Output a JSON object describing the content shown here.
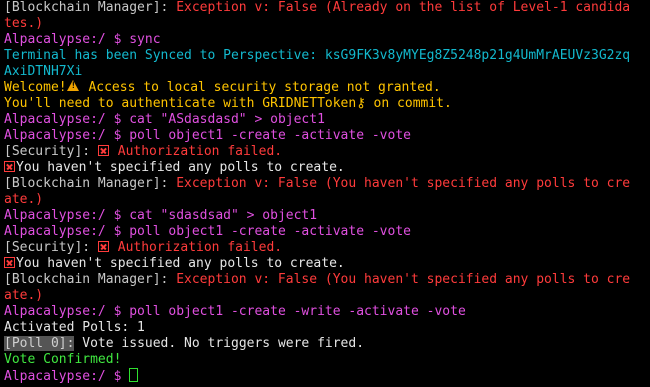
{
  "prompt": "Alpacalypse:/ $",
  "lines": {
    "l1_a": "[Blockchain Manager]: ",
    "l1_b": "Exception v: False (Already on the list of Level-1 candida",
    "l2": "tes.)",
    "l3_cmd": " sync",
    "l4": "Terminal has been Synced to Perspective: ksG9FK3v8yMYEg8Z5248p21g4UmMrAEUVz3G2zq",
    "l5": "AxiDTNH7Xi",
    "l6_a": "Welcome!",
    "l6_b": " Access to local security storage not granted.",
    "l7_a": "You'll need to authenticate with GRIDNETToken",
    "l7_key": "⚷",
    "l7_b": " on commit.",
    "l8_cmd": " cat \"ASdasdasd\" > object1",
    "l9_cmd": " poll object1 -create -activate -vote",
    "l10_a": "[Security]: ",
    "l10_b": " Authorization failed.",
    "l11": "You haven't specified any polls to create.",
    "l12_a": "[Blockchain Manager]: ",
    "l12_b": "Exception v: False (You haven't specified any polls to cre",
    "l13": "ate.)",
    "l14_cmd": " cat \"sdasdsad\" > object1",
    "l15_cmd": " poll object1 -create -activate -vote",
    "l16_a": "[Security]: ",
    "l16_b": " Authorization failed.",
    "l17": "You haven't specified any polls to create.",
    "l18_a": "[Blockchain Manager]: ",
    "l18_b": "Exception v: False (You haven't specified any polls to cre",
    "l19": "ate.)",
    "l20_cmd": " poll object1 -create -write -activate -vote",
    "l21": "Activated Polls: 1",
    "l22_label": "[Poll 0]:",
    "l22_b": " Vote issued. No triggers were fired.",
    "l23": "Vote Confirmed!"
  },
  "icons": {
    "error": "x-box-icon",
    "warning": "warning-icon",
    "key": "key-icon"
  },
  "colors": {
    "background": "#000000",
    "prompt": "#e050e0",
    "error": "#ff3b3b",
    "success": "#43d843",
    "info": "#13b9ce",
    "warning": "#ffc400"
  }
}
